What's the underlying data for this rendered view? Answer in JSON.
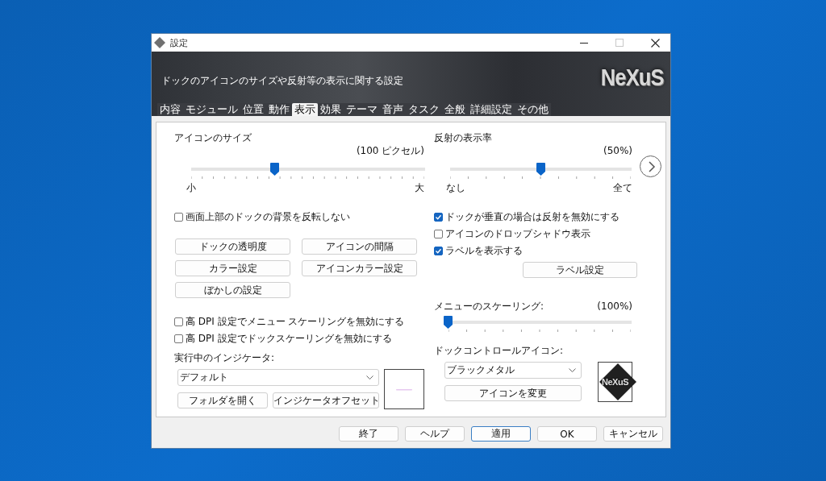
{
  "window": {
    "title": "設定"
  },
  "banner": {
    "description": "ドックのアイコンのサイズや反射等の表示に関する設定",
    "logo": "NeXuS"
  },
  "tabs": [
    {
      "label": "内容",
      "selected": false
    },
    {
      "label": "モジュール",
      "selected": false
    },
    {
      "label": "位置",
      "selected": false
    },
    {
      "label": "動作",
      "selected": false
    },
    {
      "label": "表示",
      "selected": true
    },
    {
      "label": "効果",
      "selected": false
    },
    {
      "label": "テーマ",
      "selected": false
    },
    {
      "label": "音声",
      "selected": false
    },
    {
      "label": "タスク",
      "selected": false
    },
    {
      "label": "全般",
      "selected": false
    },
    {
      "label": "詳細設定",
      "selected": false
    },
    {
      "label": "その他",
      "selected": false
    }
  ],
  "left": {
    "size_slider": {
      "label": "アイコンのサイズ",
      "reading": "(100 ピクセル)",
      "level": 0.36,
      "min_label": "小",
      "max_label": "大"
    },
    "checkboxes": [
      {
        "label": "画面上部のドックの背景を反転しない",
        "checked": false
      }
    ],
    "buttons": [
      "ドックの透明度",
      "アイコンの間隔",
      "カラー設定",
      "アイコンカラー設定",
      "ぼかしの設定"
    ],
    "dpi_checkboxes": [
      {
        "label": "高 DPI 設定でメニュー スケーリングを無効にする",
        "checked": false
      },
      {
        "label": "高 DPI 設定でドックスケーリングを無効にする",
        "checked": false
      }
    ],
    "indicator": {
      "label": "実行中のインジケータ:",
      "dropdown": "デフォルト",
      "buttons": [
        "フォルダを開く",
        "インジケータオフセット"
      ]
    }
  },
  "right": {
    "reflection_slider": {
      "label": "反射の表示率",
      "reading": "(50%)",
      "level": 0.5,
      "min_label": "なし",
      "max_label": "全て"
    },
    "checkboxes": [
      {
        "label": "ドックが垂直の場合は反射を無効にする",
        "checked": true
      },
      {
        "label": "アイコンのドロップシャドウ表示",
        "checked": false
      },
      {
        "label": "ラベルを表示する",
        "checked": true
      }
    ],
    "label_button": "ラベル設定",
    "menu_scaling": {
      "label": "メニューのスケーリング:",
      "reading": "(100%)",
      "level": 0
    },
    "dock_icon": {
      "label": "ドックコントロールアイコン:",
      "dropdown": "ブラックメタル",
      "button": "アイコンを変更",
      "preview_logo": "NeXuS"
    }
  },
  "footer_buttons": [
    {
      "label": "終了",
      "default": false
    },
    {
      "label": "ヘルプ",
      "default": false
    },
    {
      "label": "適用",
      "default": true
    },
    {
      "label": "OK",
      "default": false
    },
    {
      "label": "キャンセル",
      "default": false
    }
  ]
}
